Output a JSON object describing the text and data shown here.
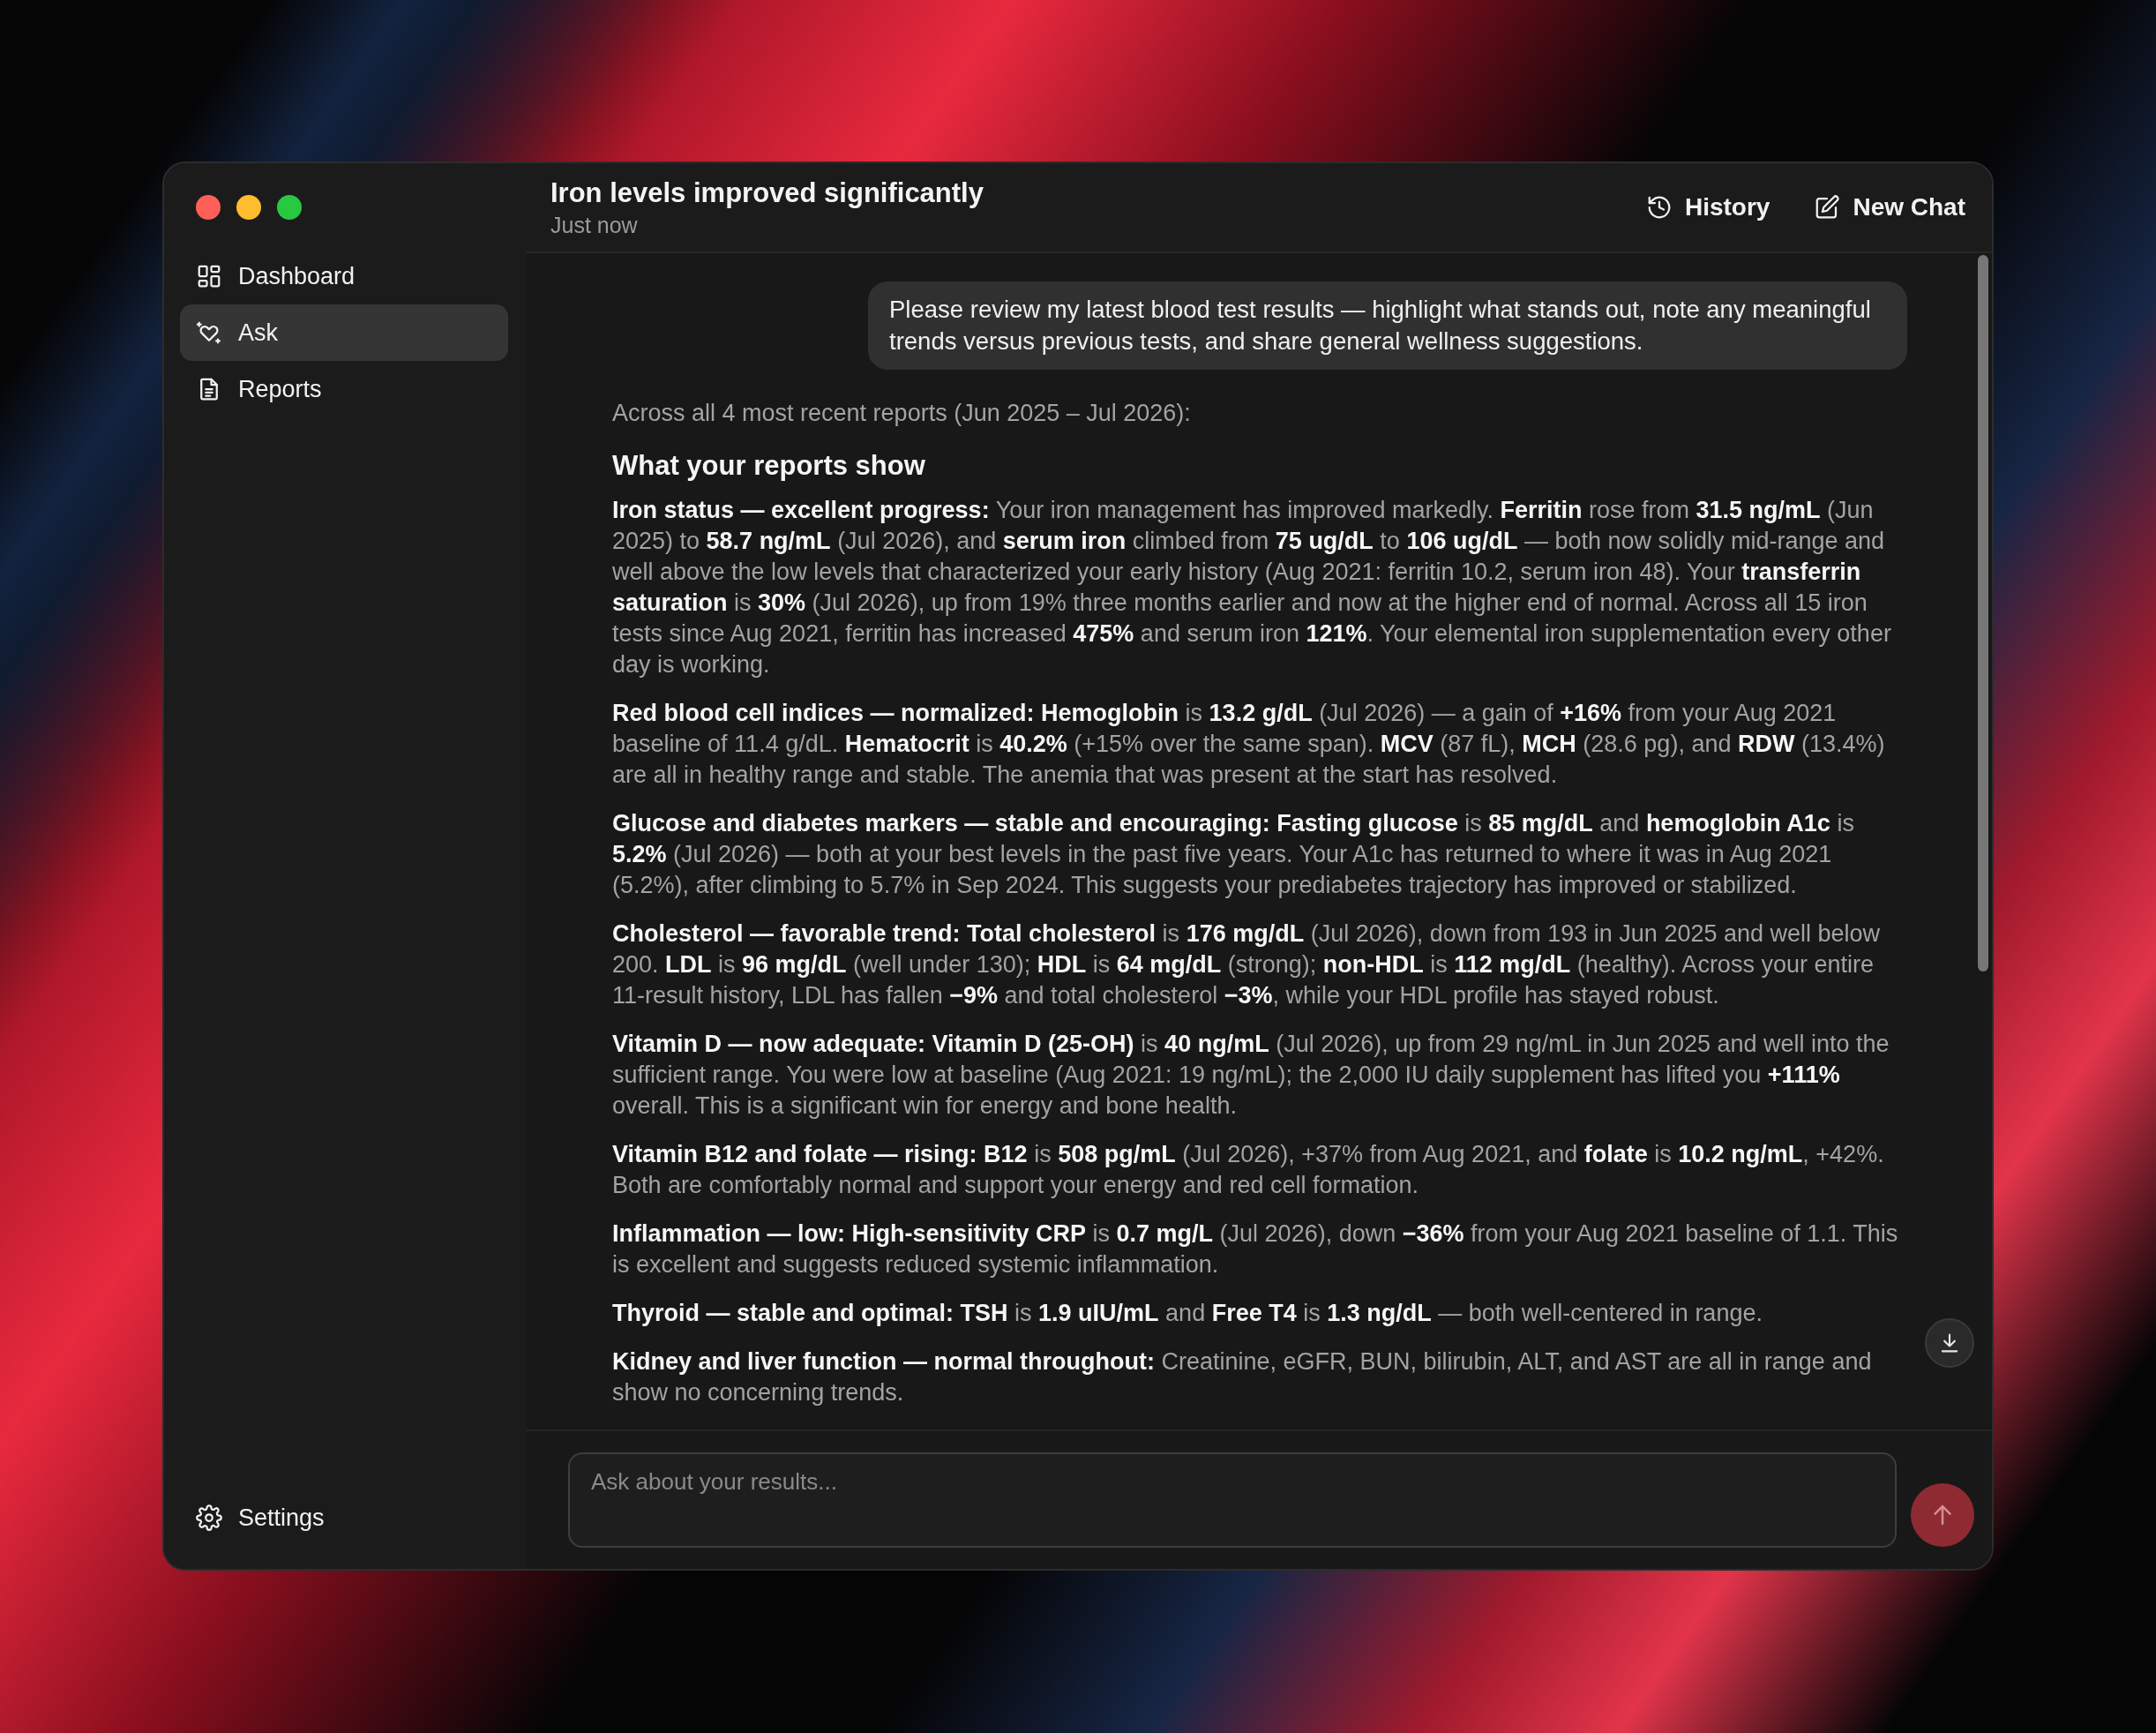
{
  "sidebar": {
    "items": [
      {
        "label": "Dashboard",
        "selected": false
      },
      {
        "label": "Ask",
        "selected": true
      },
      {
        "label": "Reports",
        "selected": false
      }
    ],
    "footer": {
      "label": "Settings"
    }
  },
  "header": {
    "title": "Iron levels improved significantly",
    "subtitle": "Just now",
    "actions": [
      {
        "label": "History"
      },
      {
        "label": "New Chat"
      }
    ]
  },
  "user_message": {
    "text": "Please review my latest blood test results — highlight what stands out, note any meaningful trends versus previous tests, and share general wellness suggestions."
  },
  "answer": {
    "intro": "Across all 4 most recent reports (Jun 2025 – Jul 2026):",
    "heading": "What your reports show",
    "paragraphs": [
      "**Iron status — excellent progress:** Your iron management has improved markedly. **Ferritin** rose from **31.5 ng/mL** (Jun 2025) to **58.7 ng/mL** (Jul 2026), and **serum iron** climbed from **75 ug/dL** to **106 ug/dL** — both now solidly mid-range and well above the low levels that characterized your early history (Aug 2021: ferritin 10.2, serum iron 48). Your **transferrin saturation** is **30%** (Jul 2026), up from 19% three months earlier and now at the higher end of normal. Across all 15 iron tests since Aug 2021, ferritin has increased **475%** and serum iron **121%**. Your elemental iron supplementation every other day is working.",
      "**Red blood cell indices — normalized: Hemoglobin** is **13.2 g/dL** (Jul 2026) — a gain of **+16%** from your Aug 2021 baseline of 11.4 g/dL. **Hematocrit** is **40.2%** (+15% over the same span). **MCV** (87 fL), **MCH** (28.6 pg), and **RDW** (13.4%) are all in healthy range and stable. The anemia that was present at the start has resolved.",
      "**Glucose and diabetes markers — stable and encouraging: Fasting glucose** is **85 mg/dL** and **hemoglobin A1c** is **5.2%** (Jul 2026) — both at your best levels in the past five years. Your A1c has returned to where it was in Aug 2021 (5.2%), after climbing to 5.7% in Sep 2024. This suggests your prediabetes trajectory has improved or stabilized.",
      "**Cholesterol — favorable trend: Total cholesterol** is **176 mg/dL** (Jul 2026), down from 193 in Jun 2025 and well below 200. **LDL** is **96 mg/dL** (well under 130); **HDL** is **64 mg/dL** (strong); **non-HDL** is **112 mg/dL** (healthy). Across your entire 11-result history, LDL has fallen **−9%** and total cholesterol **−3%**, while your HDL profile has stayed robust.",
      "**Vitamin D — now adequate: Vitamin D (25-OH)** is **40 ng/mL** (Jul 2026), up from 29 ng/mL in Jun 2025 and well into the sufficient range. You were low at baseline (Aug 2021: 19 ng/mL); the 2,000 IU daily supplement has lifted you **+111%** overall. This is a significant win for energy and bone health.",
      "**Vitamin B12 and folate — rising: B12** is **508 pg/mL** (Jul 2026), +37% from Aug 2021, and **folate** is **10.2 ng/mL**, +42%. Both are comfortably normal and support your energy and red cell formation.",
      "**Inflammation — low: High-sensitivity CRP** is **0.7 mg/L** (Jul 2026), down **−36%** from your Aug 2021 baseline of 1.1. This is excellent and suggests reduced systemic inflammation.",
      "**Thyroid — stable and optimal: TSH** is **1.9 uIU/mL** and **Free T4** is **1.3 ng/dL** — both well-centered in range.",
      "**Kidney and liver function — normal throughout:** Creatinine, eGFR, BUN, bilirubin, ALT, and AST are all in range and show no concerning trends."
    ]
  },
  "composer": {
    "placeholder": "Ask about your results...",
    "send_disabled": true
  }
}
